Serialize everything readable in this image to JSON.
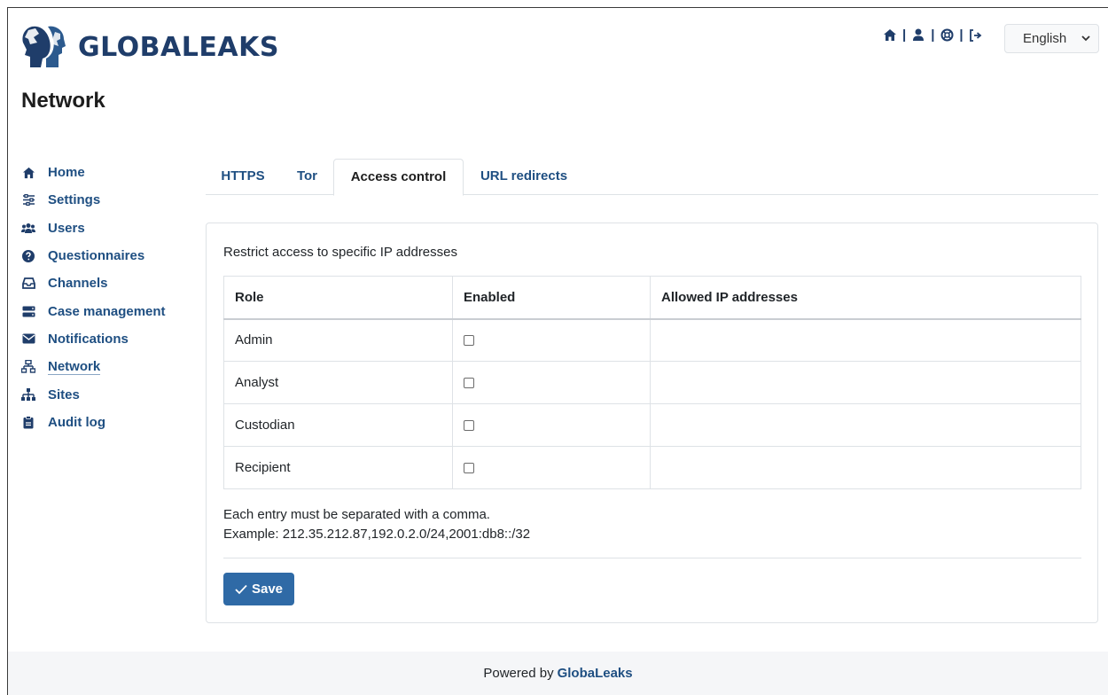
{
  "brand": {
    "name": "GLOBALEAKS"
  },
  "page": {
    "title": "Network"
  },
  "header": {
    "icons": [
      "home-icon",
      "user-icon",
      "lifebuoy-icon",
      "logout-icon"
    ],
    "language": "English"
  },
  "sidebar": {
    "items": [
      {
        "label": "Home",
        "icon": "home-icon"
      },
      {
        "label": "Settings",
        "icon": "sliders-icon"
      },
      {
        "label": "Users",
        "icon": "users-icon"
      },
      {
        "label": "Questionnaires",
        "icon": "question-circle-icon"
      },
      {
        "label": "Channels",
        "icon": "inbox-icon"
      },
      {
        "label": "Case management",
        "icon": "server-icon"
      },
      {
        "label": "Notifications",
        "icon": "envelope-icon"
      },
      {
        "label": "Network",
        "icon": "network-icon",
        "active": true
      },
      {
        "label": "Sites",
        "icon": "sitemap-icon"
      },
      {
        "label": "Audit log",
        "icon": "clipboard-icon"
      }
    ]
  },
  "tabs": [
    {
      "label": "HTTPS"
    },
    {
      "label": "Tor"
    },
    {
      "label": "Access control",
      "active": true
    },
    {
      "label": "URL redirects"
    }
  ],
  "access_control": {
    "intro": "Restrict access to specific IP addresses",
    "columns": [
      "Role",
      "Enabled",
      "Allowed IP addresses"
    ],
    "rows": [
      {
        "role": "Admin",
        "enabled": false,
        "allowed": ""
      },
      {
        "role": "Analyst",
        "enabled": false,
        "allowed": ""
      },
      {
        "role": "Custodian",
        "enabled": false,
        "allowed": ""
      },
      {
        "role": "Recipient",
        "enabled": false,
        "allowed": ""
      }
    ],
    "help_line1": "Each entry must be separated with a comma.",
    "help_line2": "Example: 212.35.212.87,192.0.2.0/24,2001:db8::/32",
    "save_label": "Save"
  },
  "footer": {
    "prefix": "Powered by",
    "brand": "GlobaLeaks"
  },
  "colors": {
    "accent": "#2f6aa6",
    "link": "#1f4f82",
    "brand": "#1f3d6a"
  }
}
